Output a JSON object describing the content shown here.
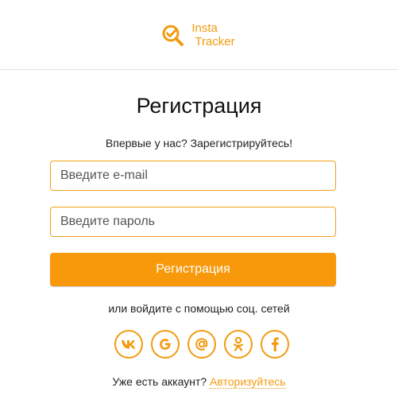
{
  "brand": {
    "name_line1": "Insta",
    "name_line2": "Tracker",
    "accent_color": "#f29b0f",
    "icon": "magnifier-check-icon"
  },
  "form": {
    "title": "Регистрация",
    "subtitle": "Впервые у нас? Зарегистрируйтесь!",
    "email_placeholder": "Введите e-mail",
    "password_placeholder": "Введите пароль",
    "submit_label": "Регистрация",
    "button_color": "#f7990a"
  },
  "social": {
    "caption": "или войдите с помощью соц. сетей",
    "items": [
      {
        "name": "vk",
        "icon": "vk-icon"
      },
      {
        "name": "google",
        "icon": "google-icon"
      },
      {
        "name": "mail",
        "icon": "at-sign-icon"
      },
      {
        "name": "odnoklassniki",
        "icon": "odnoklassniki-icon"
      },
      {
        "name": "facebook",
        "icon": "facebook-icon"
      }
    ]
  },
  "footer": {
    "question": "Уже есть аккаунт?",
    "login_link": "Авторизуйтесь"
  }
}
